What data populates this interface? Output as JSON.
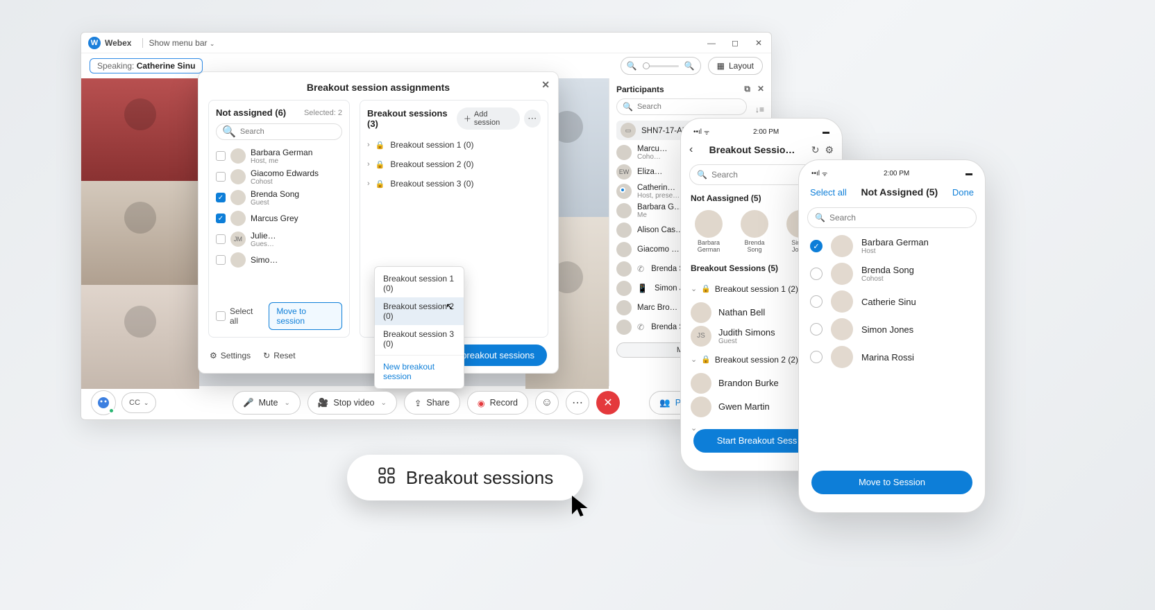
{
  "desktop": {
    "app_name": "Webex",
    "menu_bar": "Show menu bar",
    "speaking_label": "Speaking:",
    "speaking_name": "Catherine Sinu",
    "layout_btn": "Layout"
  },
  "participants_panel": {
    "title": "Participants",
    "search_placeholder": "Search",
    "room": {
      "name": "SHN7-17-APR5"
    },
    "list": [
      {
        "name": "Marcu…",
        "sub": "Coho…"
      },
      {
        "name": "Eliza…",
        "initials": "EW"
      },
      {
        "name": "Catherin…",
        "sub": "Host, prese…",
        "dot": true
      },
      {
        "name": "Barbara G…",
        "sub": "Me"
      },
      {
        "name": "Alison Cas…"
      },
      {
        "name": "Giacomo …"
      },
      {
        "name": "Brenda So…",
        "device": "phone"
      },
      {
        "name": "Simon Jo…",
        "device": "mobile"
      },
      {
        "name": "Marc Bro…"
      },
      {
        "name": "Brenda So…",
        "device": "phone"
      }
    ],
    "mute_all": "Mute All"
  },
  "dialog": {
    "title": "Breakout session assignments",
    "left": {
      "title": "Not assigned (6)",
      "selected_label": "Selected: 2",
      "search_placeholder": "Search",
      "users": [
        {
          "name": "Barbara German",
          "sub": "Host, me",
          "checked": false
        },
        {
          "name": "Giacomo Edwards",
          "sub": "Cohost",
          "checked": false
        },
        {
          "name": "Brenda Song",
          "sub": "Guest",
          "checked": true
        },
        {
          "name": "Marcus Grey",
          "sub": "",
          "checked": true
        },
        {
          "name": "Julie…",
          "sub": "Gues…",
          "checked": false,
          "initials": "JM"
        },
        {
          "name": "Simo…",
          "sub": "",
          "checked": false
        }
      ],
      "select_all": "Select all",
      "move_btn": "Move to session"
    },
    "right": {
      "title": "Breakout sessions (3)",
      "add_btn": "Add session",
      "sessions": [
        "Breakout session 1 (0)",
        "Breakout session 2 (0)",
        "Breakout session 3 (0)"
      ]
    },
    "ctx": {
      "items": [
        "Breakout session 1 (0)",
        "Breakout session 2 (0)",
        "Breakout session 3 (0)"
      ],
      "new_session": "New breakout session"
    },
    "settings": "Settings",
    "reset": "Reset",
    "start": "Start breakout sessions"
  },
  "toolbar": {
    "mute": "Mute",
    "stop_video": "Stop video",
    "share": "Share",
    "record": "Record",
    "participants": "Participants",
    "cc": "CC"
  },
  "phone1": {
    "time": "2:00 PM",
    "title": "Breakout Sessio…",
    "search_placeholder": "Search",
    "not_assigned_title": "Not Aassigned (5)",
    "avatars": [
      {
        "name": "Barbara German"
      },
      {
        "name": "Brenda Song"
      },
      {
        "name": "Simon Jones"
      }
    ],
    "sessions_title": "Breakout Sessions (5)",
    "acc1": "Breakout session 1 (2)",
    "acc1_rows": [
      {
        "name": "Nathan Bell"
      },
      {
        "name": "Judith Simons",
        "sub": "Guest",
        "initials": "JS"
      }
    ],
    "acc2": "Breakout session 2 (2)",
    "acc2_rows": [
      {
        "name": "Brandon Burke"
      },
      {
        "name": "Gwen Martin"
      }
    ],
    "start_btn": "Start Breakout Sess…"
  },
  "phone2": {
    "time": "2:00 PM",
    "select_all": "Select all",
    "title": "Not Assigned (5)",
    "done": "Done",
    "search_placeholder": "Search",
    "rows": [
      {
        "name": "Barbara German",
        "sub": "Host",
        "checked": true
      },
      {
        "name": "Brenda Song",
        "sub": "Cohost",
        "checked": false
      },
      {
        "name": "Catherie Sinu",
        "checked": false
      },
      {
        "name": "Simon Jones",
        "checked": false
      },
      {
        "name": "Marina Rossi",
        "checked": false
      }
    ],
    "move_btn": "Move to Session"
  },
  "big_button": "Breakout sessions"
}
